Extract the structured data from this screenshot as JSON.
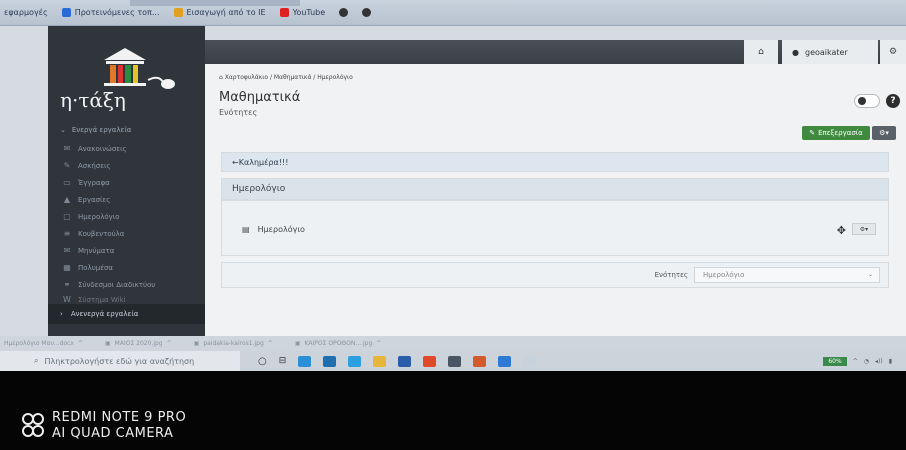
{
  "browser": {
    "bookmarks": [
      {
        "label": "εφαρμογές",
        "color": ""
      },
      {
        "label": "Προτεινόμενες τοπ...",
        "color": "#2b6bd6"
      },
      {
        "label": "Εισαγωγή από το IE",
        "color": "#e0a020"
      },
      {
        "label": "YouTube",
        "color": "#e02020"
      }
    ]
  },
  "topnav": {
    "home_icon": "home-icon",
    "username": "geoaikater",
    "settings_icon": "gear-icon"
  },
  "sidebar": {
    "brand": "η·τάξη",
    "section_active": "Ενεργά εργαλεία",
    "items": [
      {
        "label": "Ανακοινώσεις",
        "icon": "megaphone-icon",
        "glyph": "✉"
      },
      {
        "label": "Ασκήσεις",
        "icon": "pencil-icon",
        "glyph": "✎"
      },
      {
        "label": "Έγγραφα",
        "icon": "folder-icon",
        "glyph": "▭"
      },
      {
        "label": "Εργασίες",
        "icon": "flask-icon",
        "glyph": "▲"
      },
      {
        "label": "Ημερολόγιο",
        "icon": "calendar-icon",
        "glyph": "▢"
      },
      {
        "label": "Κουβεντούλα",
        "icon": "chat-icon",
        "glyph": "≡"
      },
      {
        "label": "Μηνύματα",
        "icon": "envelope-icon",
        "glyph": "✉"
      },
      {
        "label": "Πολυμέσα",
        "icon": "film-icon",
        "glyph": "▦"
      },
      {
        "label": "Σύνδεσμοι Διαδικτύου",
        "icon": "link-icon",
        "glyph": "⚭"
      },
      {
        "label": "Σύστημα Wiki",
        "icon": "wiki-icon",
        "glyph": "W"
      }
    ],
    "section_inactive": "Ανενεργά εργαλεία"
  },
  "main": {
    "breadcrumb": "Χαρτοφυλάκιο / Μαθηματικά / Ημερολόγιο",
    "title": "Μαθηματικά",
    "subtitle": "Ενότητες",
    "edit_label": "Επεξεργασία",
    "welcome": "Καλημέρα!!!",
    "calendar_heading": "Ημερολόγιο",
    "calendar_item": "Ημερολόγιο",
    "units_label": "Ενότητες",
    "units_select": "Ημερολόγιο"
  },
  "downloads": [
    "Ημερολόγιο Μαν...docx",
    "ΜΑΙΟΣ 2020.jpg",
    "paidakia-kairos1.jpg",
    "ΚΑΙΡΟΣ ΟΡΟΘΟΝ....jpg"
  ],
  "taskbar": {
    "search_placeholder": "Πληκτρολογήστε εδώ για αναζήτηση",
    "battery": "60%"
  },
  "camera": {
    "line1": "REDMI NOTE 9 PRO",
    "line2": "AI QUAD CAMERA"
  }
}
